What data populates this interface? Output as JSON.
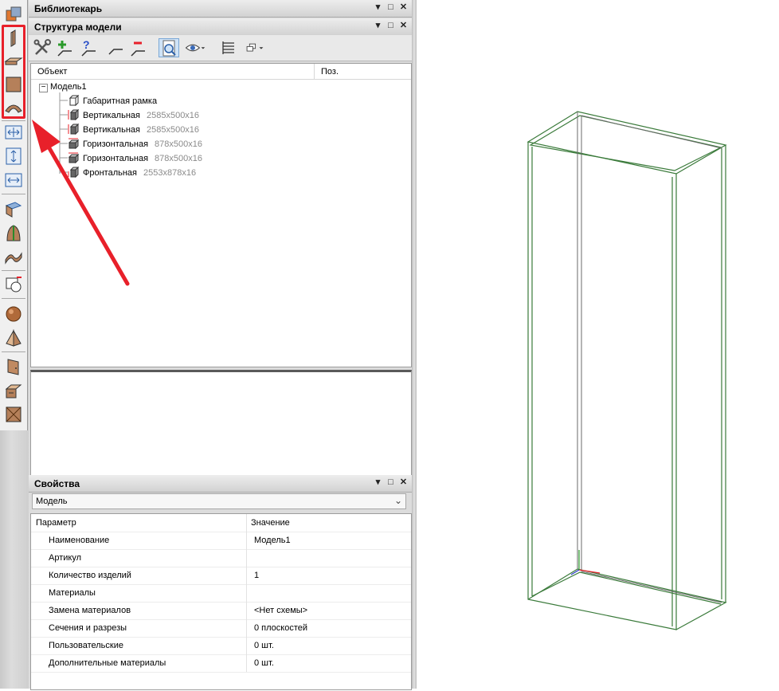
{
  "library_panel": {
    "title": "Библиотекарь"
  },
  "structure_panel": {
    "title": "Структура модели",
    "columns": {
      "object": "Объект",
      "position": "Поз."
    },
    "root": "Модель1",
    "items": [
      {
        "name": "Габаритная рамка",
        "size": ""
      },
      {
        "name": "Вертикальная",
        "size": "2585x500x16"
      },
      {
        "name": "Вертикальная",
        "size": "2585x500x16"
      },
      {
        "name": "Горизонтальная",
        "size": "878x500x16"
      },
      {
        "name": "Горизонтальная",
        "size": "878x500x16"
      },
      {
        "name": "Фронтальная",
        "size": "2553x878x16"
      }
    ]
  },
  "properties_panel": {
    "title": "Свойства",
    "selector_value": "Модель",
    "header": {
      "param": "Параметр",
      "value": "Значение"
    },
    "rows": [
      {
        "param": "Наименование",
        "value": "Модель1"
      },
      {
        "param": "Артикул",
        "value": ""
      },
      {
        "param": "Количество изделий",
        "value": "1"
      },
      {
        "param": "Материалы",
        "value": ""
      },
      {
        "param": "Замена материалов",
        "value": "<Нет схемы>"
      },
      {
        "param": "Сечения и разрезы",
        "value": "0 плоскостей"
      },
      {
        "param": "Пользовательские",
        "value": "0 шт."
      },
      {
        "param": "Дополнительные материалы",
        "value": "0 шт."
      }
    ]
  },
  "window_buttons": {
    "minimize": "▾",
    "maximize": "□",
    "close": "✕"
  },
  "colors": {
    "highlight": "#e8202a",
    "model_edges": "#3a7a3a",
    "panel_face": "#b5805a"
  }
}
